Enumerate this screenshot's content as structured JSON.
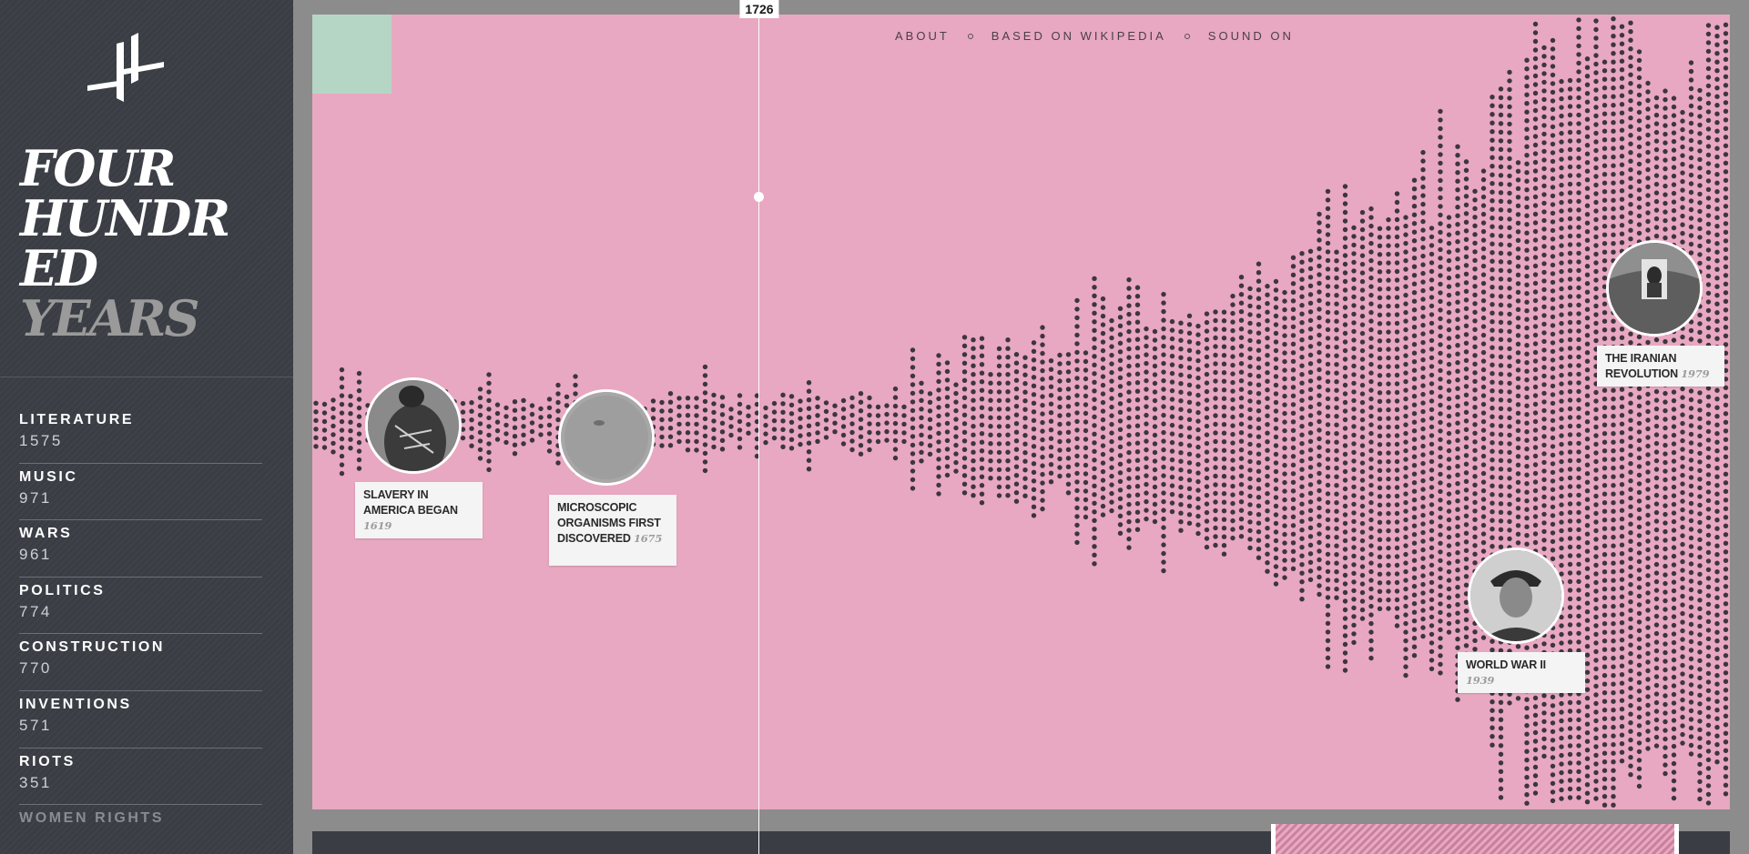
{
  "app": {
    "title_lines": [
      "FOUR",
      "HUNDR",
      "ED",
      "YEARS"
    ],
    "logo": "four-hundred-years-logo"
  },
  "sidebar": {
    "categories": [
      {
        "name": "LITERATURE",
        "count": "1575"
      },
      {
        "name": "MUSIC",
        "count": "971"
      },
      {
        "name": "WARS",
        "count": "961"
      },
      {
        "name": "POLITICS",
        "count": "774"
      },
      {
        "name": "CONSTRUCTION",
        "count": "770"
      },
      {
        "name": "INVENTIONS",
        "count": "571"
      },
      {
        "name": "RIOTS",
        "count": "351"
      },
      {
        "name": "WOMEN RIGHTS",
        "count": ""
      }
    ]
  },
  "nav": {
    "about": "ABOUT",
    "source": "BASED ON WIKIPEDIA",
    "sound": "SOUND ON"
  },
  "cursor": {
    "year": "1726"
  },
  "events": [
    {
      "title_lines": [
        "SLAVERY IN",
        "AMERICA BEGAN"
      ],
      "year": "1619",
      "icon": "slavery-photo"
    },
    {
      "title_lines": [
        "MICROSCOPIC",
        "ORGANISMS FIRST",
        "DISCOVERED"
      ],
      "year": "1675",
      "icon": "microscopic-photo"
    },
    {
      "title_lines": [
        "THE IRANIAN",
        "REVOLUTION"
      ],
      "year": "1979",
      "icon": "iranian-revolution-photo"
    },
    {
      "title_lines": [
        "WORLD WAR II"
      ],
      "year": "1939",
      "icon": "world-war-ii-photo"
    }
  ],
  "colors": {
    "stage_bg": "#e8a8c1",
    "sidebar_bg": "#3a3d44",
    "dot": "#3d3540",
    "accent_mint": "#b6d6c5",
    "frame": "#8c8c8c"
  }
}
